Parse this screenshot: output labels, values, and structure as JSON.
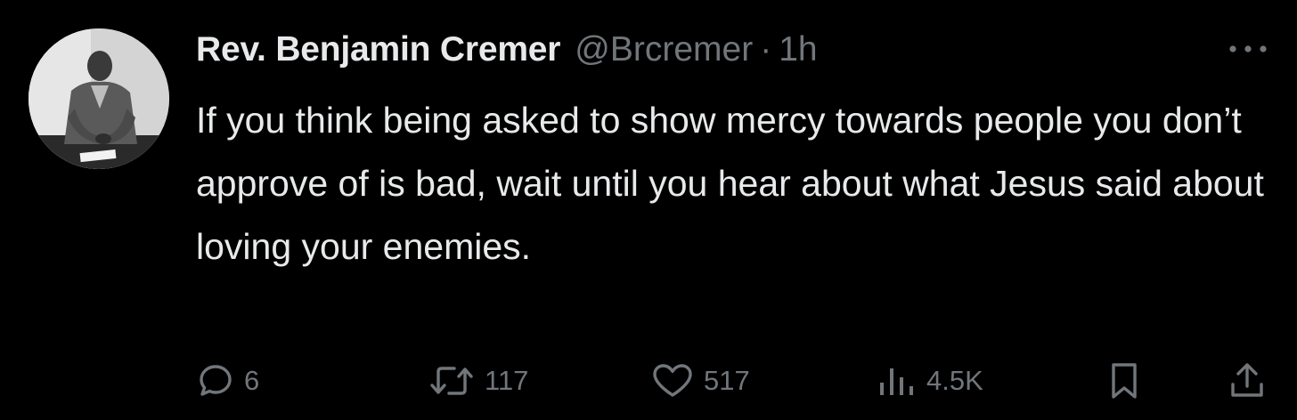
{
  "tweet": {
    "display_name": "Rev. Benjamin Cremer",
    "handle": "@Brcremer",
    "separator": "·",
    "time": "1h",
    "text": "If you think being asked to show mercy towards people you don’t approve of is bad, wait until you hear about what Jesus said about loving your enemies."
  },
  "actions": {
    "reply_count": "6",
    "retweet_count": "117",
    "like_count": "517",
    "views_count": "4.5K"
  },
  "icons": {
    "reply": "speech-bubble-icon",
    "retweet": "retweet-arrows-icon",
    "like": "heart-icon",
    "views": "bar-chart-icon",
    "bookmark": "bookmark-icon",
    "share": "share-upload-icon",
    "more": "more-dots-icon"
  },
  "colors": {
    "background": "#000000",
    "primary_text": "#e7e9ea",
    "secondary_text": "#71767b"
  }
}
